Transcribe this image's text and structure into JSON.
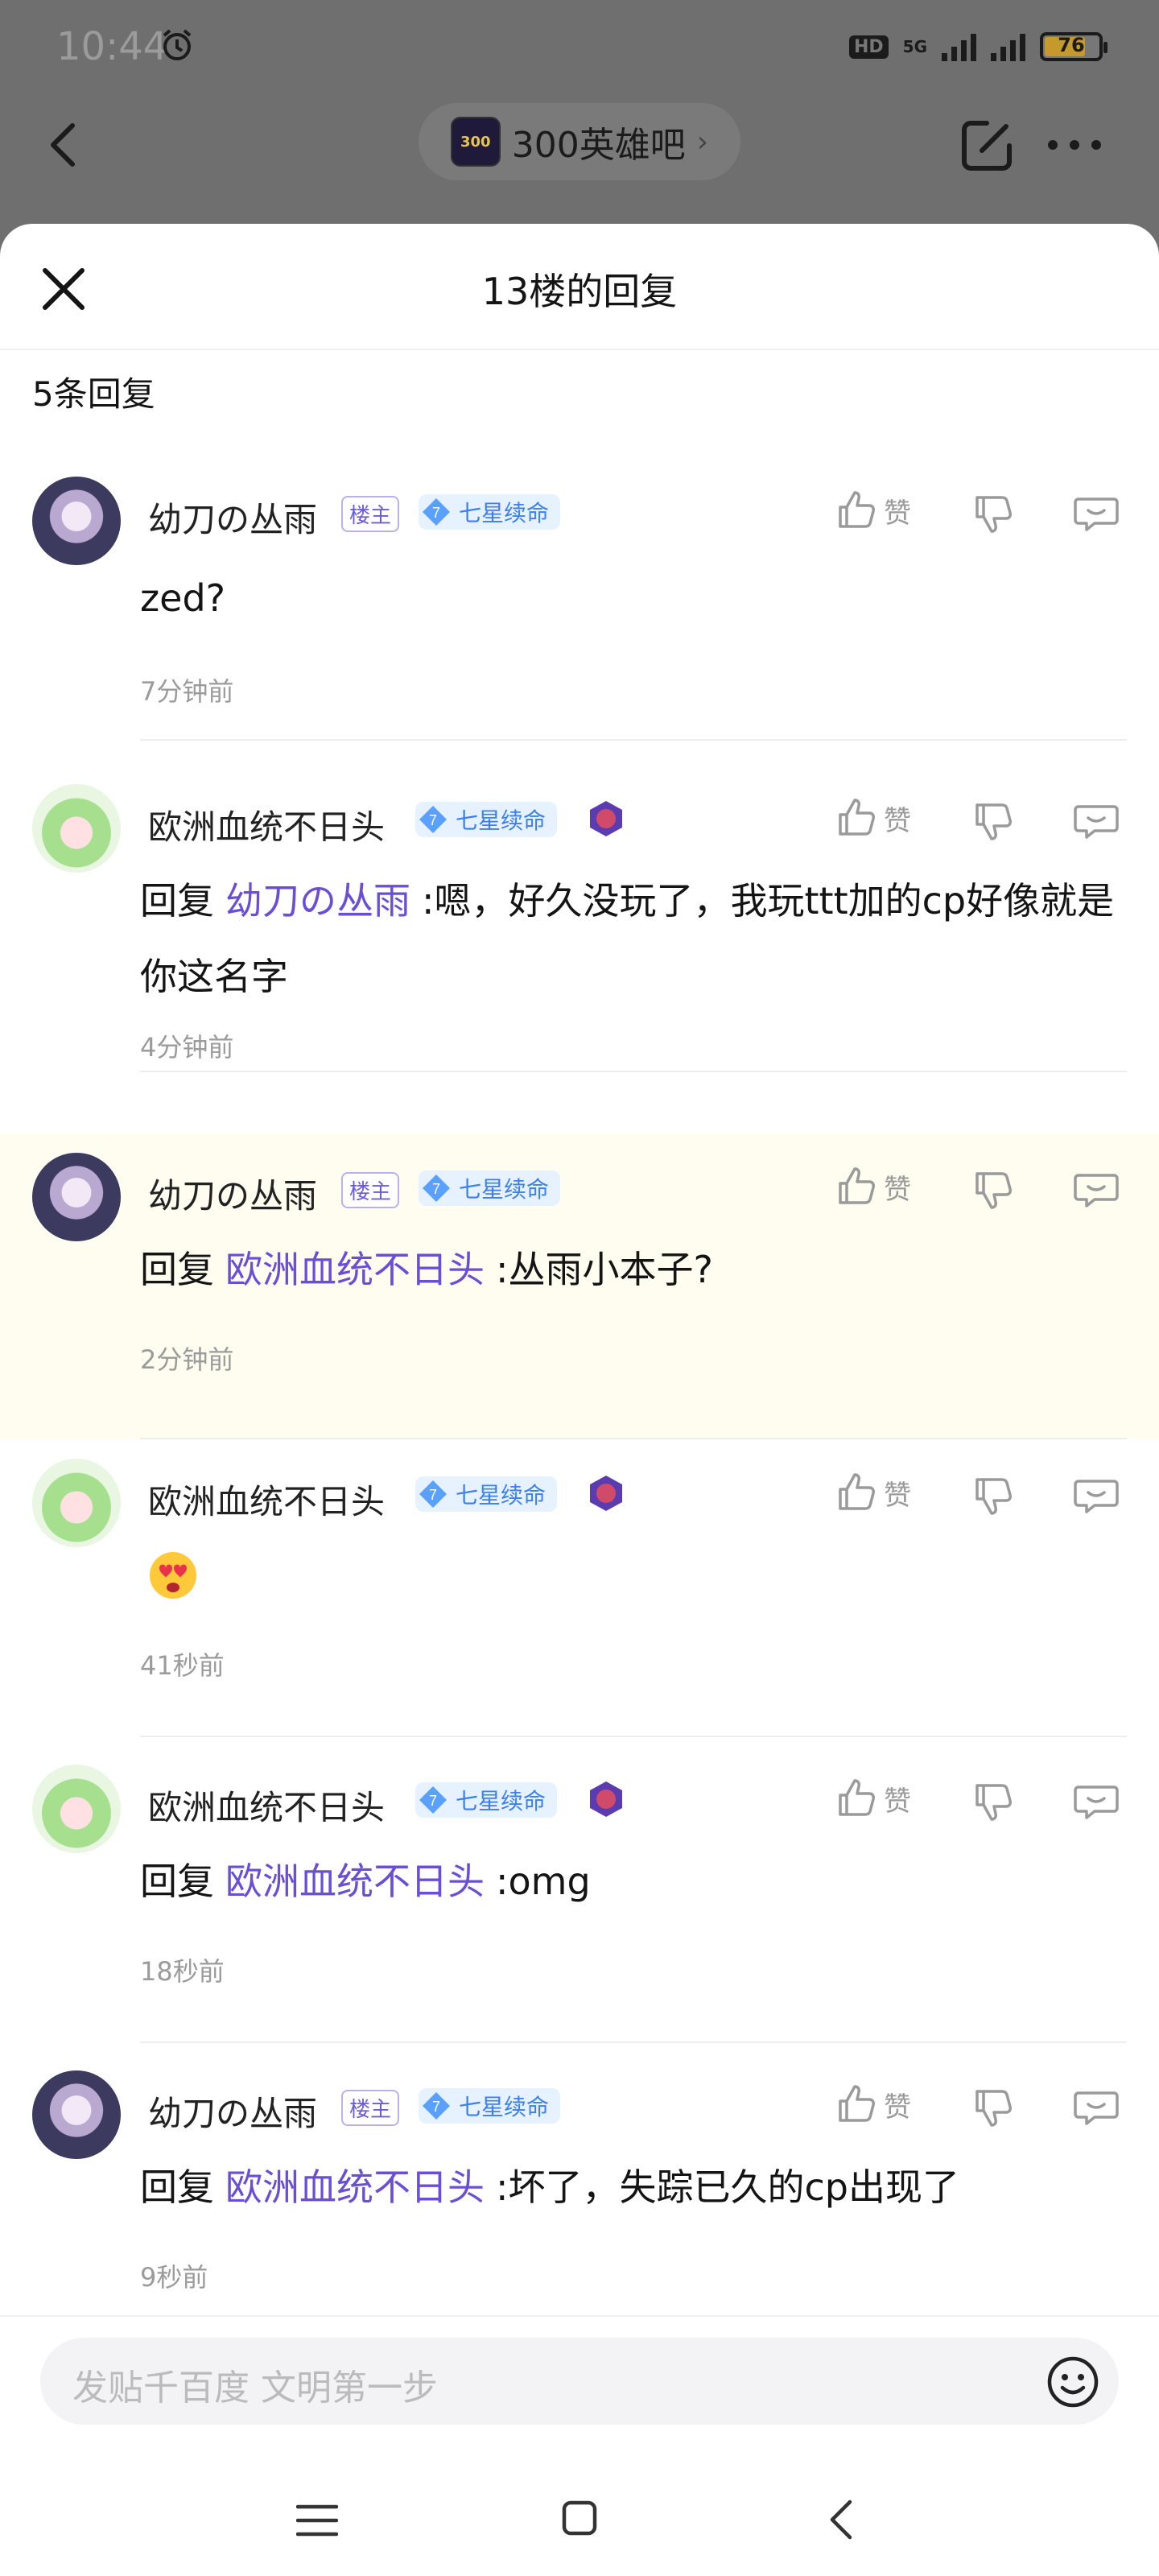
{
  "status": {
    "time": "10:44",
    "network": "5G",
    "hd": "HD",
    "battery": "76"
  },
  "forum": {
    "name": "300英雄吧",
    "logo_text": "300"
  },
  "sheet": {
    "title": "13楼的回复",
    "reply_count": "5条回复"
  },
  "labels": {
    "owner_tag": "楼主",
    "like": "赞",
    "reply_prefix": "回复",
    "level_num": "7"
  },
  "replies": [
    {
      "user": "幼刀の丛雨",
      "owner": true,
      "level_title": "七星续命",
      "mention": "",
      "text": "zed?",
      "time": "7分钟前",
      "hero_badge": false
    },
    {
      "user": "欧洲血统不日头",
      "owner": false,
      "level_title": "七星续命",
      "mention": "幼刀の丛雨",
      "text": ":嗯，好久没玩了，我玩ttt加的cp好像就是你这名字",
      "time": "4分钟前",
      "hero_badge": true
    },
    {
      "user": "幼刀の丛雨",
      "owner": true,
      "level_title": "七星续命",
      "mention": "欧洲血统不日头",
      "text": ":丛雨小本子?",
      "time": "2分钟前",
      "hero_badge": false,
      "highlighted": true
    },
    {
      "user": "欧洲血统不日头",
      "owner": false,
      "level_title": "七星续命",
      "mention": "",
      "text": "",
      "emoji": "heart-eyes",
      "time": "41秒前",
      "hero_badge": true
    },
    {
      "user": "欧洲血统不日头",
      "owner": false,
      "level_title": "七星续命",
      "mention": "欧洲血统不日头",
      "text": ":omg",
      "time": "18秒前",
      "hero_badge": true
    },
    {
      "user": "幼刀の丛雨",
      "owner": true,
      "level_title": "七星续命",
      "mention": "欧洲血统不日头",
      "text": ":坏了，失踪已久的cp出现了",
      "time": "9秒前",
      "hero_badge": false
    }
  ],
  "input": {
    "placeholder": "发贴千百度 文明第一步"
  },
  "colors": {
    "mention": "#6a4fd6",
    "level": "#3b7ff0",
    "highlight_bg": "#fffdf0"
  }
}
